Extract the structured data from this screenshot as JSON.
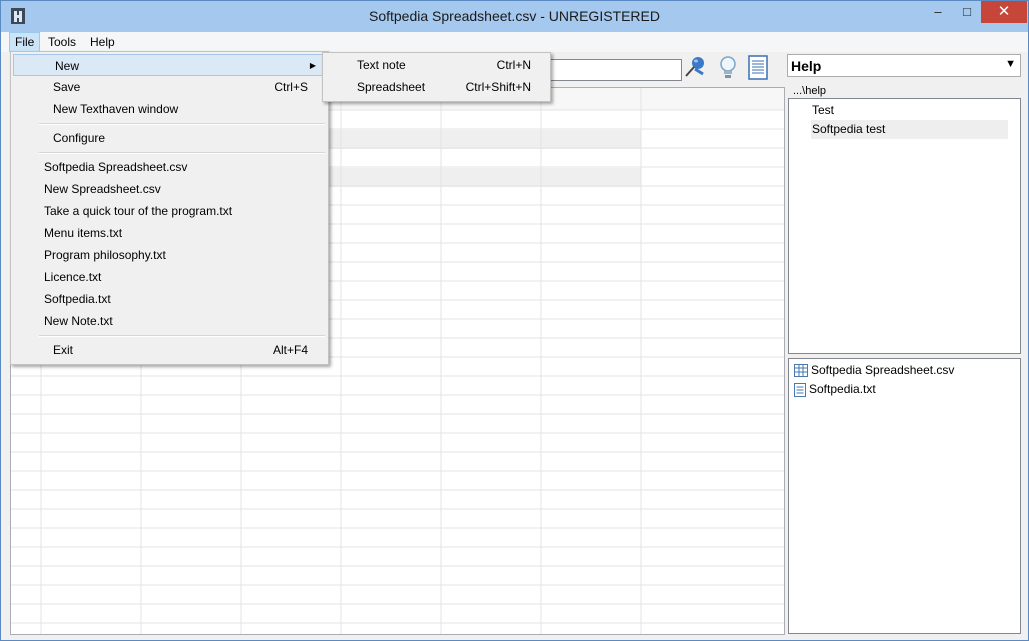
{
  "window": {
    "title": "Softpedia Spreadsheet.csv - UNREGISTERED"
  },
  "titlebar_buttons": {
    "minimize": "–",
    "maximize": "□",
    "close": "✕"
  },
  "menubar": {
    "items": [
      "File",
      "Tools",
      "Help"
    ]
  },
  "file_menu": {
    "new": "New",
    "save": "Save",
    "save_shortcut": "Ctrl+S",
    "new_window": "New Texthaven window",
    "configure": "Configure",
    "recent": [
      "Softpedia Spreadsheet.csv",
      "New Spreadsheet.csv",
      "Take a quick tour of the program.txt",
      "Menu items.txt",
      "Program philosophy.txt",
      "Licence.txt",
      "Softpedia.txt",
      "New Note.txt"
    ],
    "exit": "Exit",
    "exit_shortcut": "Alt+F4"
  },
  "new_submenu": {
    "text_note": "Text note",
    "text_note_shortcut": "Ctrl+N",
    "spreadsheet": "Spreadsheet",
    "spreadsheet_shortcut": "Ctrl+Shift+N"
  },
  "help_panel": {
    "selected": "Help",
    "path": "...\\help",
    "topics": [
      "Test",
      "Softpedia test"
    ],
    "files": [
      "Softpedia Spreadsheet.csv",
      "Softpedia.txt"
    ]
  },
  "colors": {
    "titlebar": "#a5c8ee",
    "close": "#c7463a",
    "highlight": "#dbe8f6",
    "row_shade": "#efefef"
  },
  "icons": [
    "pin-icon",
    "lightbulb-icon",
    "document-icon",
    "spreadsheet-file-icon",
    "text-file-icon"
  ]
}
